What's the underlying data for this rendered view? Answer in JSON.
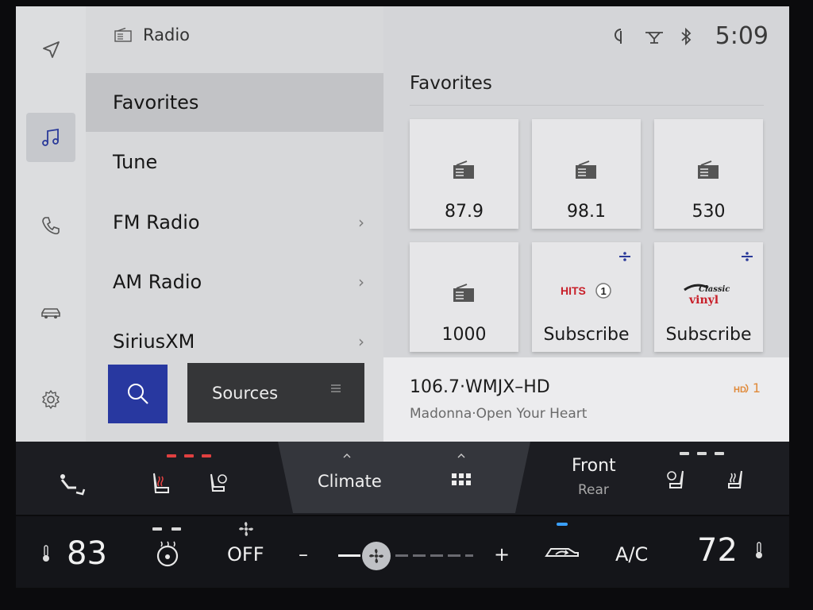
{
  "header": {
    "source_title": "Radio",
    "time": "5:09"
  },
  "rail": {
    "items": [
      "navigation-icon",
      "music-icon",
      "phone-icon",
      "vehicle-icon",
      "settings-icon"
    ],
    "active": "music-icon"
  },
  "menu": {
    "items": [
      {
        "label": "Favorites",
        "selected": true,
        "chevron": false
      },
      {
        "label": "Tune",
        "selected": false,
        "chevron": false
      },
      {
        "label": "FM Radio",
        "selected": false,
        "chevron": true
      },
      {
        "label": "AM Radio",
        "selected": false,
        "chevron": true
      },
      {
        "label": "SiriusXM",
        "selected": false,
        "chevron": true
      }
    ],
    "chevron_glyph": "›",
    "sources_label": "Sources"
  },
  "favorites": {
    "title": "Favorites",
    "tiles": [
      {
        "label": "87.9",
        "icon": "radio-icon"
      },
      {
        "label": "98.1",
        "icon": "radio-icon"
      },
      {
        "label": "530",
        "icon": "radio-icon"
      },
      {
        "label": "1000",
        "icon": "radio-icon"
      },
      {
        "label": "Subscribe",
        "logo_text": "HITS",
        "logo_badge": "1",
        "icon": "siriusxm-icon"
      },
      {
        "label": "Subscribe",
        "logo_text": "Classic",
        "logo_text2": "vinyl",
        "icon": "siriusxm-icon"
      }
    ]
  },
  "now_playing": {
    "station": "106.7·WMJX–HD",
    "track": "Madonna·Open Your Heart",
    "hd_channel": "1"
  },
  "climate": {
    "tab_label": "Climate",
    "front_label": "Front",
    "rear_label": "Rear",
    "driver_temp": "83",
    "passenger_temp": "72",
    "fan_status": "OFF",
    "fan_minus": "–",
    "fan_plus": "+",
    "ac_label": "A/C",
    "fan_level": 0.2,
    "colors": {
      "heat_active": "#e04040",
      "recirc_active": "#3aa0ff",
      "accent_blue": "#2838a0",
      "hd_orange": "#e08a3a"
    }
  }
}
